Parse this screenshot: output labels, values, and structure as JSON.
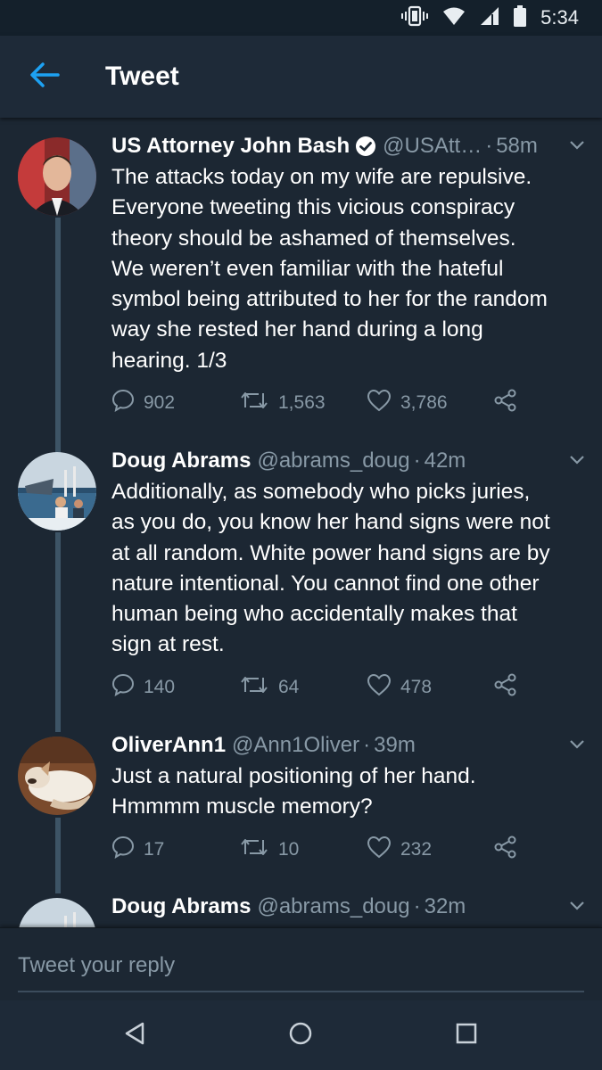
{
  "status_bar": {
    "time": "5:34"
  },
  "app_bar": {
    "title": "Tweet"
  },
  "tweets": [
    {
      "name": "US Attorney John Bash",
      "verified": true,
      "handle": "@USAtt…",
      "dot": "·",
      "time": "58m",
      "text": "The attacks today on my wife are repulsive.\nEveryone tweeting this vicious conspiracy\ntheory should be ashamed of themselves.\nWe weren’t even familiar with the hateful\nsymbol being attributed to her for the random\nway she rested her hand during a long\nhearing. 1/3",
      "replies": "902",
      "retweets": "1,563",
      "likes": "3,786"
    },
    {
      "name": "Doug Abrams",
      "verified": false,
      "handle": "@abrams_doug",
      "dot": "·",
      "time": "42m",
      "text": "Additionally, as somebody who picks juries,\nas you do, you know her hand signs were not\nat all random.  White power hand signs are by\nnature intentional.  You cannot find one other\nhuman being who accidentally makes that\nsign at rest.",
      "replies": "140",
      "retweets": "64",
      "likes": "478"
    },
    {
      "name": "OliverAnn1",
      "verified": false,
      "handle": "@Ann1Oliver",
      "dot": "·",
      "time": "39m",
      "text": "Just a natural positioning of her hand.\nHmmmm muscle memory?",
      "replies": "17",
      "retweets": "10",
      "likes": "232"
    },
    {
      "name": "Doug Abrams",
      "verified": false,
      "handle": "@abrams_doug",
      "dot": "·",
      "time": "32m"
    }
  ],
  "reply_bar": {
    "placeholder": "Tweet your reply"
  },
  "colors": {
    "background": "#1c2733",
    "app_bar": "#1e2a38",
    "accent_blue": "#1da1f2",
    "muted_text": "#8899a6",
    "thread_line": "#3d5466"
  },
  "icons": {
    "back": "arrow-left-icon",
    "reply": "speech-bubble-icon",
    "retweet": "retweet-icon",
    "like": "heart-icon",
    "share": "share-icon",
    "caret": "chevron-down-icon",
    "verified": "verified-badge-icon"
  }
}
